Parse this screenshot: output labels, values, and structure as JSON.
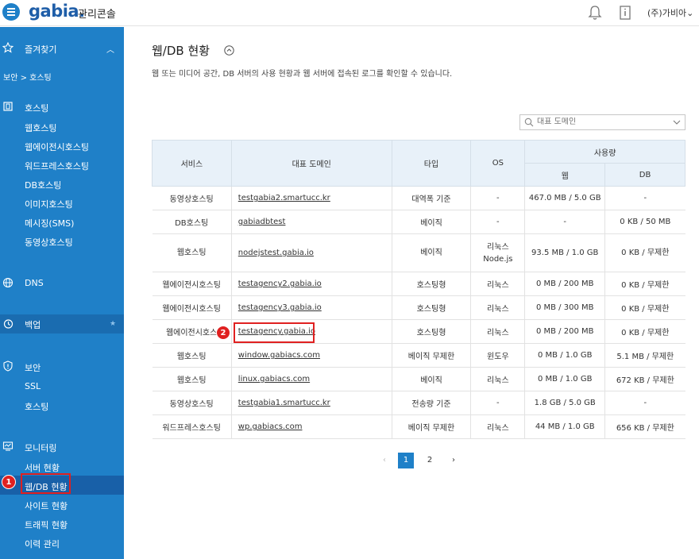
{
  "header": {
    "logo": "gabia.",
    "title": "관리콘솔",
    "account": "(주)가비아"
  },
  "sidebar": {
    "favorites_label": "즐겨찾기",
    "breadcrumb": "보안 > 호스팅",
    "hosting": {
      "label": "호스팅",
      "items": [
        "웹호스팅",
        "웹에이전시호스팅",
        "워드프레스호스팅",
        "DB호스팅",
        "이미지호스팅",
        "메시징(SMS)",
        "동영상호스팅"
      ]
    },
    "dns_label": "DNS",
    "backup_label": "백업",
    "security": {
      "label": "보안",
      "items": [
        "SSL",
        "호스팅"
      ]
    },
    "monitoring": {
      "label": "모니터링",
      "items": [
        "서버 현황",
        "웹/DB 현황",
        "사이트 현황",
        "트래픽 현황",
        "이력 관리"
      ]
    }
  },
  "markers": [
    "1",
    "2"
  ],
  "main": {
    "title": "웹/DB 현황",
    "description": "웹 또는 미디어 공간, DB 서버의 사용 현황과 웹 서버에 접속된 로그를 확인할 수 있습니다.",
    "search_placeholder": "대표 도메인",
    "table": {
      "headers": {
        "service": "서비스",
        "domain": "대표 도메인",
        "type": "타입",
        "os": "OS",
        "usage": "사용량",
        "web": "웹",
        "db": "DB"
      },
      "rows": [
        {
          "service": "동영상호스팅",
          "domain": "testgabia2.smartucc.kr",
          "type": "대역폭 기준",
          "os": "-",
          "os2": "",
          "web": "467.0 MB / 5.0 GB",
          "db": "-"
        },
        {
          "service": "DB호스팅",
          "domain": "gabiadbtest",
          "type": "베이직",
          "os": "-",
          "os2": "",
          "web": "-",
          "db": "0 KB / 50 MB"
        },
        {
          "service": "웹호스팅",
          "domain": "nodejstest.gabia.io",
          "type": "베이직",
          "os": "리눅스",
          "os2": "Node.js",
          "web": "93.5 MB / 1.0 GB",
          "db": "0 KB / 무제한"
        },
        {
          "service": "웹에이전시호스팅",
          "domain": "testagency2.gabia.io",
          "type": "호스팅형",
          "os": "리눅스",
          "os2": "",
          "web": "0 MB / 200 MB",
          "db": "0 KB / 무제한"
        },
        {
          "service": "웹에이전시호스팅",
          "domain": "testagency3.gabia.io",
          "type": "호스팅형",
          "os": "리눅스",
          "os2": "",
          "web": "0 MB / 300 MB",
          "db": "0 KB / 무제한"
        },
        {
          "service": "웹에이전시호스",
          "domain": "testagency.gabia.io",
          "type": "호스팅형",
          "os": "리눅스",
          "os2": "",
          "web": "0 MB / 200 MB",
          "db": "0 KB / 무제한"
        },
        {
          "service": "웹호스팅",
          "domain": "window.gabiacs.com",
          "type": "베이직 무제한",
          "os": "윈도우",
          "os2": "",
          "web": "0 MB / 1.0 GB",
          "db": "5.1 MB / 무제한"
        },
        {
          "service": "웹호스팅",
          "domain": "linux.gabiacs.com",
          "type": "베이직",
          "os": "리눅스",
          "os2": "",
          "web": "0 MB / 1.0 GB",
          "db": "672 KB / 무제한"
        },
        {
          "service": "동영상호스팅",
          "domain": "testgabia1.smartucc.kr",
          "type": "전송량 기준",
          "os": "-",
          "os2": "",
          "web": "1.8 GB / 5.0 GB",
          "db": "-"
        },
        {
          "service": "워드프레스호스팅",
          "domain": "wp.gabiacs.com",
          "type": "베이직 무제한",
          "os": "리눅스",
          "os2": "",
          "web": "44 MB / 1.0 GB",
          "db": "656 KB / 무제한"
        }
      ]
    },
    "pagination": {
      "prev": "‹",
      "pages": [
        "1",
        "2"
      ],
      "next": "›",
      "current": "1"
    }
  },
  "colors": {
    "sidebar": "#1f80c8",
    "active": "#1860a8",
    "marker": "#e02020",
    "header_cell": "#e8f1f9"
  }
}
